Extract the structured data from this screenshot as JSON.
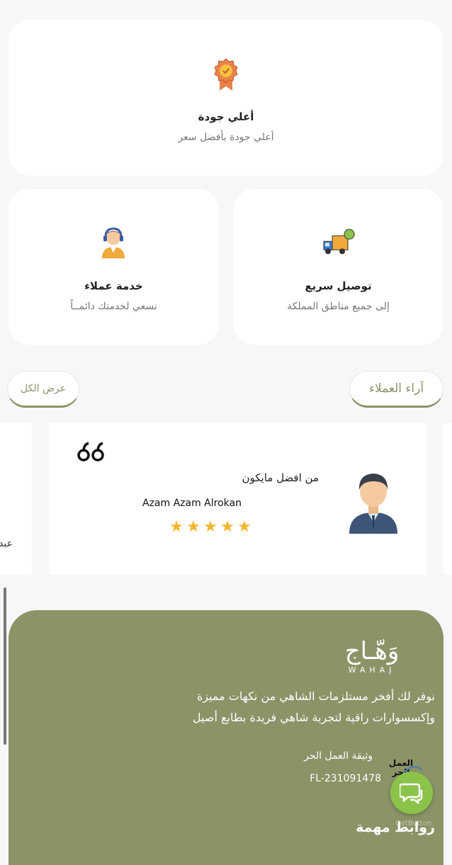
{
  "features": {
    "quality": {
      "title": "أعلي جودة",
      "subtitle": "أعلي جودة بأفضل سعر",
      "icon": "award-badge-icon"
    },
    "support": {
      "title": "خدمة عملاء",
      "subtitle": "نسعي لخدمتك دائمــاً",
      "icon": "customer-support-icon"
    },
    "delivery": {
      "title": "توصيل سريع",
      "subtitle": "إلى جميع مناطق المملكة",
      "icon": "delivery-truck-icon"
    }
  },
  "reviews": {
    "heading": "آراء العملاء",
    "view_all": "عرض الكل",
    "items": [
      {
        "text": "من افضل مايكون",
        "author": "Azam Azam Alrokan",
        "rating": 5
      }
    ],
    "peek_left_text": "عبد"
  },
  "footer": {
    "logo_arabic": "وَهّـاج",
    "logo_latin": "WAHAJ",
    "description_line1": "نوفر لك أفخر مستلزمات الشاهي من نكهات مميزة",
    "description_line2": "وإكسسوارات راقية لتجربة شاهي فريدة بطابع أصيل",
    "license_label": "وثيقة العمل الحر",
    "license_number": "FL-231091478",
    "license_logo_text": "العمل الحر",
    "links_heading": "روابط مهمة",
    "chat_watermark": "GetButton"
  },
  "colors": {
    "brand": "#8a9467",
    "star": "#f3b52a",
    "chat": "#8bc34a"
  }
}
